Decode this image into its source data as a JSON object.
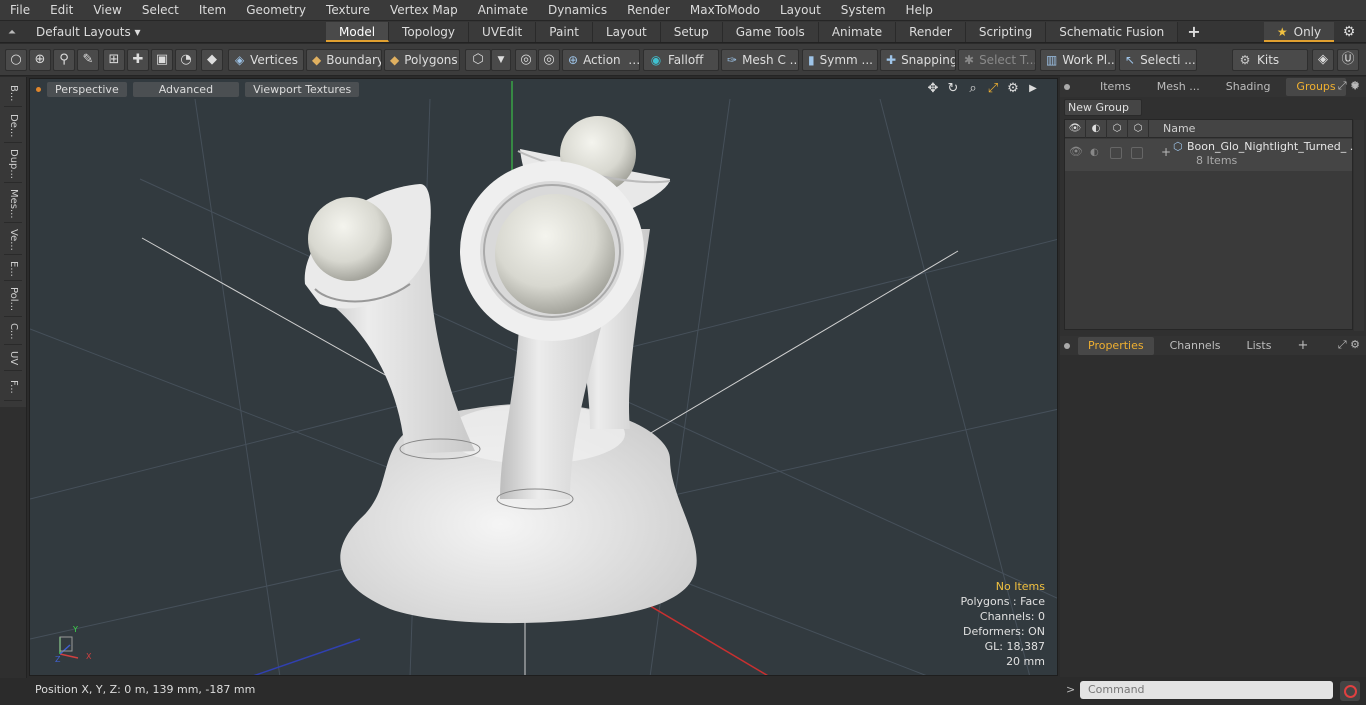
{
  "menu": [
    "File",
    "Edit",
    "View",
    "Select",
    "Item",
    "Geometry",
    "Texture",
    "Vertex Map",
    "Animate",
    "Dynamics",
    "Render",
    "MaxToModo",
    "Layout",
    "System",
    "Help"
  ],
  "layouts": {
    "label": "Default Layouts ▾"
  },
  "tabs": [
    "Model",
    "Topology",
    "UVEdit",
    "Paint",
    "Layout",
    "Setup",
    "Game Tools",
    "Animate",
    "Render",
    "Scripting",
    "Schematic Fusion"
  ],
  "tabs_active": "Model",
  "only_label": "Only",
  "toolbar": {
    "vertices": "Vertices",
    "boundary": "Boundary",
    "polygons": "Polygons",
    "action": "Action",
    "falloff": "Falloff",
    "mesh_c": "Mesh C ...",
    "symm": "Symm ...",
    "snapping": "Snapping",
    "select_t": "Select T...",
    "work_pl": "Work Pl...",
    "selecti": "Selecti ...",
    "kits": "Kits"
  },
  "left_tabs": [
    "B...",
    "De...",
    "Dup...",
    "Mes...",
    "Ve...",
    "E...",
    "Pol...",
    "C...",
    "UV",
    "F..."
  ],
  "viewport": {
    "perspective": "Perspective",
    "advanced": "Advanced",
    "viewport_textures": "Viewport Textures",
    "stats": {
      "no_items": "No Items",
      "polygons": "Polygons : Face",
      "channels": "Channels: 0",
      "deformers": "Deformers: ON",
      "gl": "GL: 18,387",
      "scale": "20 mm"
    },
    "axis": {
      "y": "Y",
      "x": "X",
      "z": "Z"
    }
  },
  "panel_top": {
    "tabs": [
      "Items",
      "Mesh ...",
      "Shading",
      "Groups"
    ],
    "active": "Groups",
    "new_group": "New Group",
    "name_header": "Name",
    "group": {
      "name": "Boon_Glo_Nightlight_Turned_ ...",
      "count": "8 Items"
    }
  },
  "panel_bottom": {
    "tabs": [
      "Properties",
      "Channels",
      "Lists"
    ],
    "active": "Properties"
  },
  "status": {
    "position": "Position X, Y, Z:   0 m, 139 mm, -187 mm"
  },
  "command": {
    "placeholder": "Command"
  }
}
